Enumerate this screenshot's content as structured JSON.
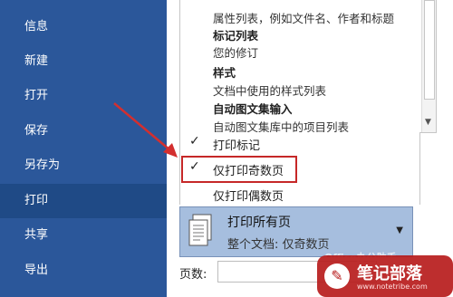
{
  "nav": {
    "items": [
      {
        "label": "信息"
      },
      {
        "label": "新建"
      },
      {
        "label": "打开"
      },
      {
        "label": "保存"
      },
      {
        "label": "另存为"
      },
      {
        "label": "打印"
      },
      {
        "label": "共享"
      },
      {
        "label": "导出"
      }
    ],
    "active": "打印"
  },
  "dropdown": {
    "lines": [
      {
        "text": "属性列表，例如文件名、作者和标题",
        "bold": false
      },
      {
        "text": "标记列表",
        "bold": true
      },
      {
        "text": "您的修订",
        "bold": false
      },
      {
        "text": "样式",
        "bold": true
      },
      {
        "text": "文档中使用的样式列表",
        "bold": false
      },
      {
        "text": "自动图文集输入",
        "bold": true
      },
      {
        "text": "自动图文集库中的项目列表",
        "bold": false
      }
    ],
    "options": [
      {
        "label": "打印标记",
        "checked": true
      },
      {
        "label": "仅打印奇数页",
        "checked": true,
        "highlighted": true
      },
      {
        "label": "仅打印偶数页",
        "checked": false
      }
    ]
  },
  "print_range": {
    "title": "打印所有页",
    "subtitle": "整个文档: 仅奇数页"
  },
  "pages": {
    "label": "页数:",
    "value": ""
  },
  "watermark": {
    "text": "笔记部落",
    "url": "www.notetribe.com",
    "overlay": "Office办公助手"
  },
  "colors": {
    "nav_bg": "#2b579a",
    "nav_active": "#1f4a86",
    "selection_bg": "#a6bede",
    "highlight_border": "#c62828"
  }
}
